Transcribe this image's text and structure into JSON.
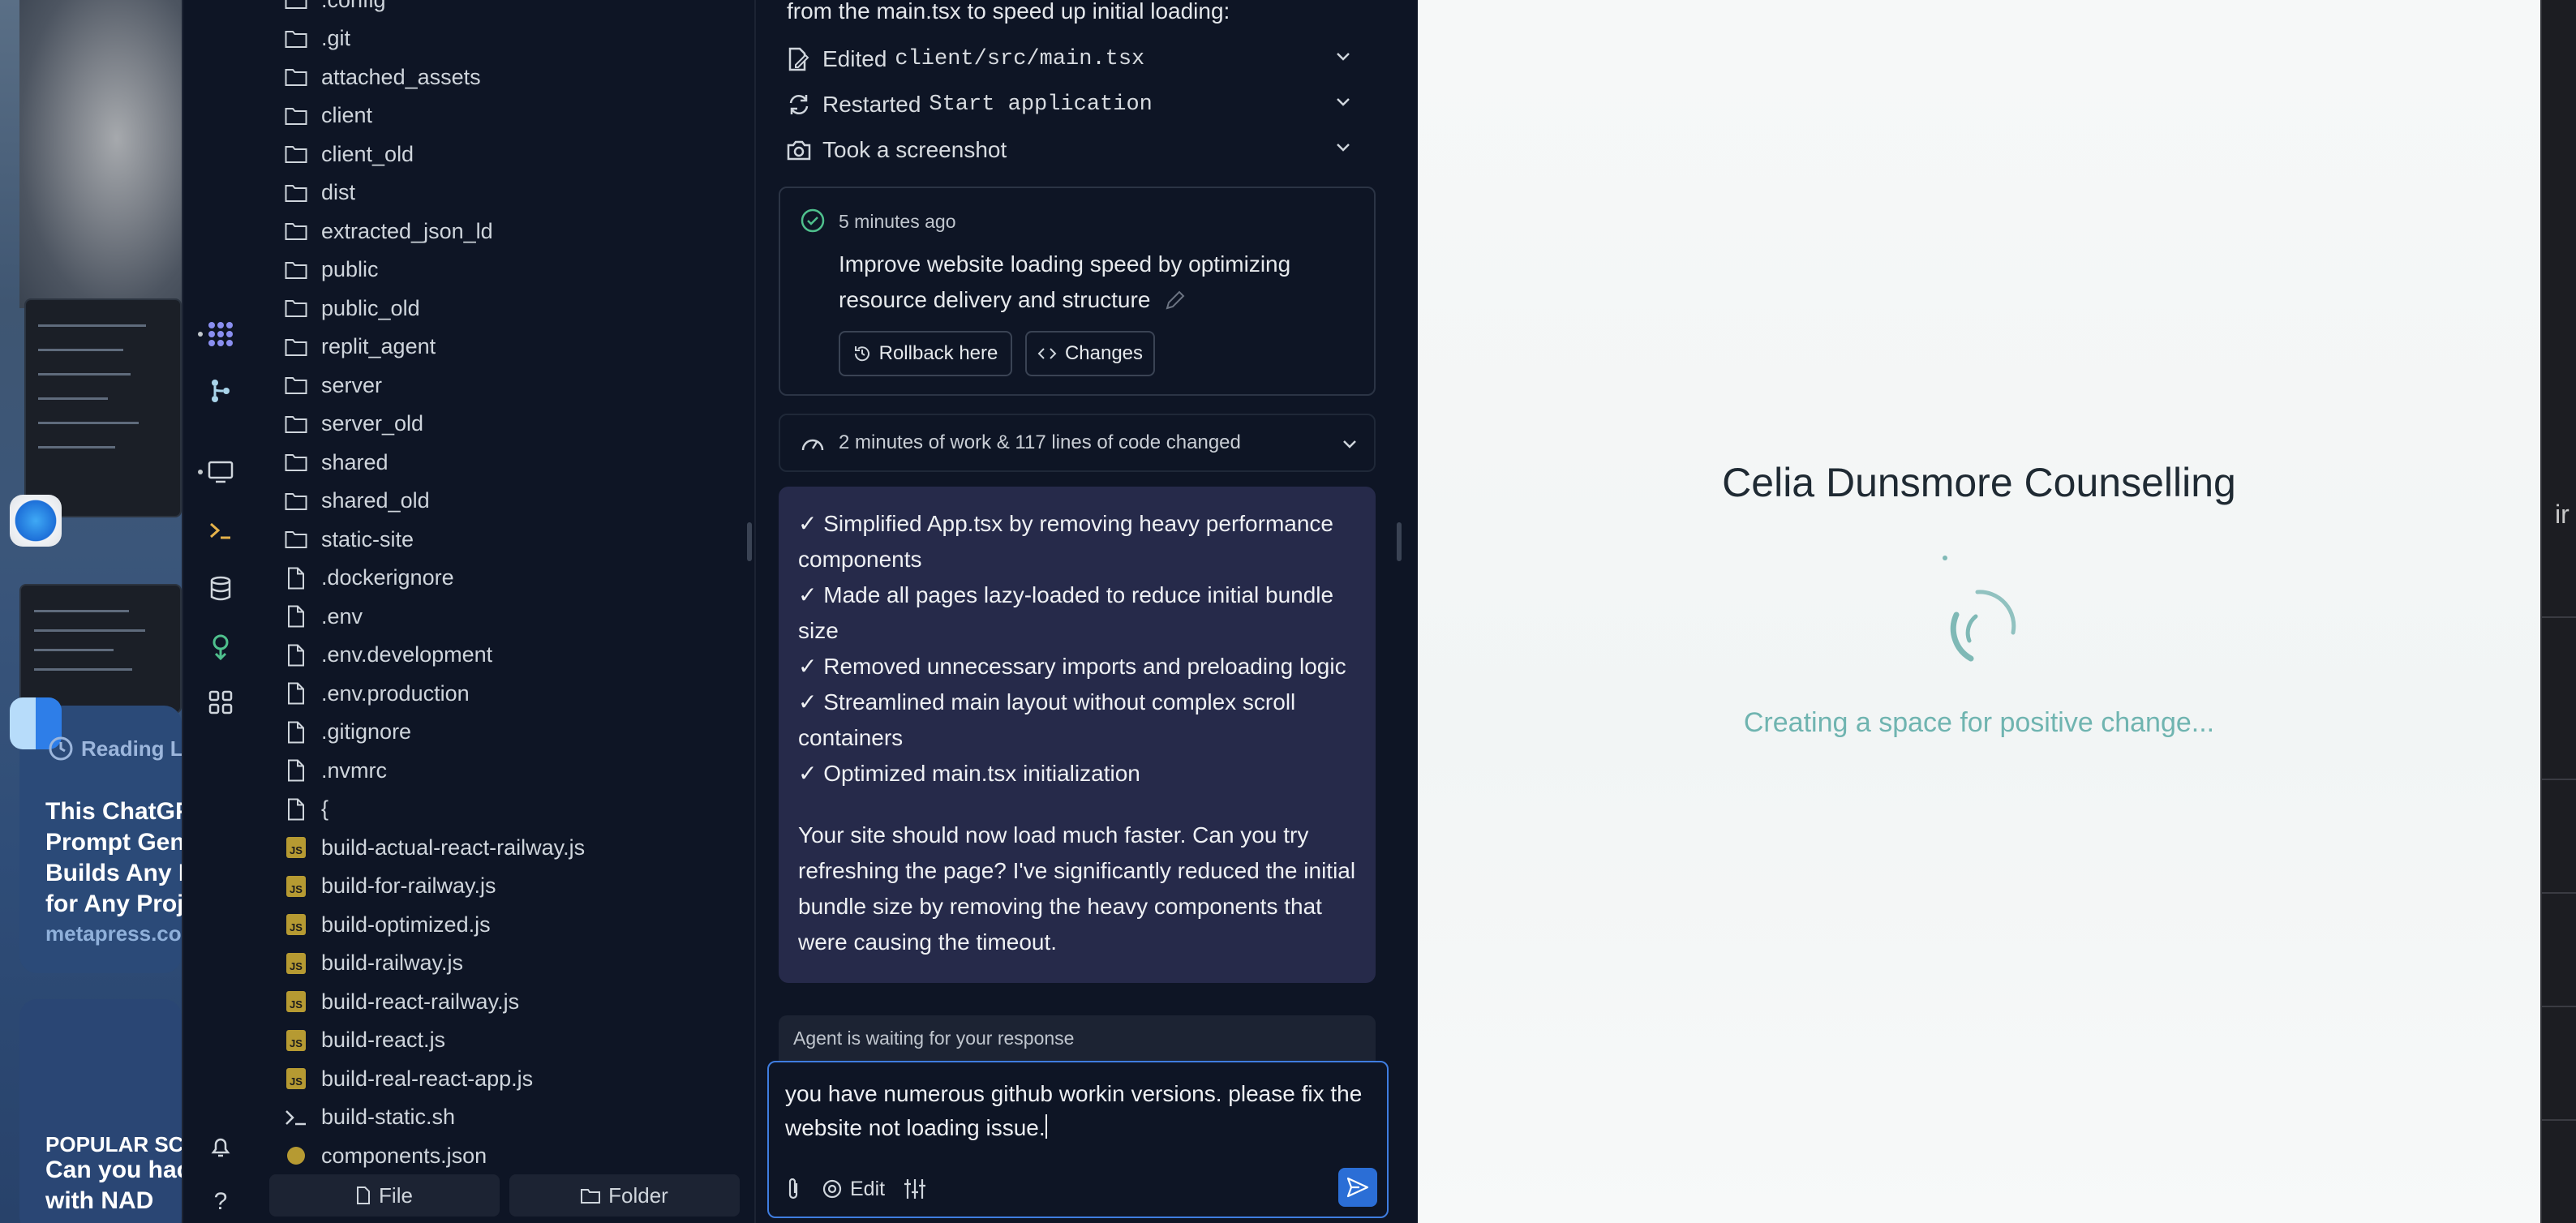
{
  "desktop": {
    "reading_label": "Reading L",
    "article_title": "This ChatGP\nPrompt Gen\nBuilds Any P\nfor Any Proj",
    "article_source": "metapress.co",
    "popular_label": "POPULAR SC",
    "popular_text": "Can you hack\nwith NAD"
  },
  "filetree": {
    "items": [
      {
        "name": ".config",
        "type": "folder"
      },
      {
        "name": ".git",
        "type": "folder"
      },
      {
        "name": "attached_assets",
        "type": "folder"
      },
      {
        "name": "client",
        "type": "folder"
      },
      {
        "name": "client_old",
        "type": "folder"
      },
      {
        "name": "dist",
        "type": "folder"
      },
      {
        "name": "extracted_json_ld",
        "type": "folder"
      },
      {
        "name": "public",
        "type": "folder"
      },
      {
        "name": "public_old",
        "type": "folder"
      },
      {
        "name": "replit_agent",
        "type": "folder"
      },
      {
        "name": "server",
        "type": "folder"
      },
      {
        "name": "server_old",
        "type": "folder"
      },
      {
        "name": "shared",
        "type": "folder"
      },
      {
        "name": "shared_old",
        "type": "folder"
      },
      {
        "name": "static-site",
        "type": "folder"
      },
      {
        "name": ".dockerignore",
        "type": "file"
      },
      {
        "name": ".env",
        "type": "file"
      },
      {
        "name": ".env.development",
        "type": "file"
      },
      {
        "name": ".env.production",
        "type": "file"
      },
      {
        "name": ".gitignore",
        "type": "file"
      },
      {
        "name": ".nvmrc",
        "type": "file"
      },
      {
        "name": "{",
        "type": "file"
      },
      {
        "name": "build-actual-react-railway.js",
        "type": "js"
      },
      {
        "name": "build-for-railway.js",
        "type": "js"
      },
      {
        "name": "build-optimized.js",
        "type": "js"
      },
      {
        "name": "build-railway.js",
        "type": "js"
      },
      {
        "name": "build-react-railway.js",
        "type": "js"
      },
      {
        "name": "build-react.js",
        "type": "js"
      },
      {
        "name": "build-real-react-app.js",
        "type": "js"
      },
      {
        "name": "build-static.sh",
        "type": "shell"
      },
      {
        "name": "components.json",
        "type": "json"
      }
    ],
    "add_file_label": "File",
    "add_folder_label": "Folder"
  },
  "chat": {
    "intro_text": "from the main.tsx to speed up initial loading:",
    "actions": [
      {
        "label": "Edited",
        "code": "client/src/main.tsx",
        "icon": "edit-file-icon"
      },
      {
        "label": "Restarted",
        "code": "Start application",
        "icon": "restart-icon"
      },
      {
        "label": "Took a screenshot",
        "code": "",
        "icon": "camera-icon"
      }
    ],
    "checkpoint": {
      "time": "5 minutes ago",
      "title": "Improve website loading speed by optimizing resource delivery and structure",
      "rollback_label": "Rollback here",
      "changes_label": "Changes"
    },
    "work_summary": "2 minutes of work & 117 lines of code changed",
    "agent_message": {
      "lines": [
        "✓ Simplified App.tsx by removing heavy performance components",
        "✓ Made all pages lazy-loaded to reduce initial bundle size",
        "✓ Removed unnecessary imports and preloading logic",
        "✓ Streamlined main layout without complex scroll containers",
        "✓ Optimized main.tsx initialization"
      ],
      "paragraph": "Your site should now load much faster. Can you try refreshing the page? I've significantly reduced the initial bundle size by removing the heavy components that were causing the timeout."
    },
    "waiting_text": "Agent is waiting for your response",
    "composer": {
      "value": "you have numerous github workin versions. please fix the website not loading issue.",
      "edit_label": "Edit"
    }
  },
  "preview": {
    "title": "Celia Dunsmore Counselling",
    "loading_text": "Creating a space for positive change..."
  },
  "right_edge": {
    "fragment": "ir"
  },
  "colors": {
    "bg": "#0e1525",
    "agent_bubble": "#262a4a",
    "accent_blue": "#2b6ed6",
    "teal": "#6fb4b0",
    "js_badge": "#b69a32"
  }
}
